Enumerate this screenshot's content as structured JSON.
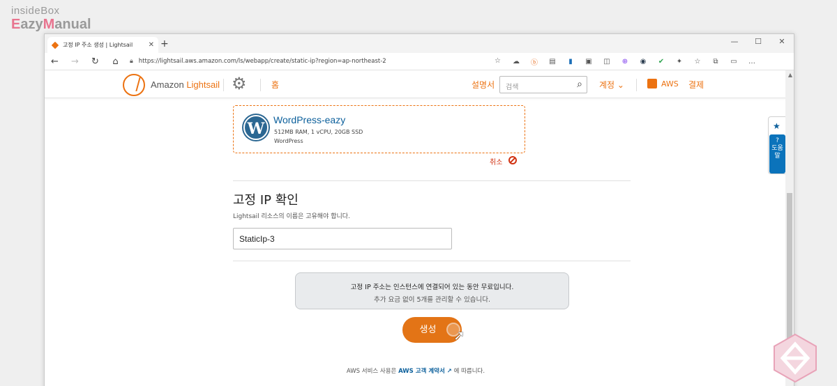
{
  "watermark": {
    "top": "insideBox",
    "bottom_em": "E",
    "bottom_rest": "azy",
    "bottom_em2": "M",
    "bottom_rest2": "anual"
  },
  "browser": {
    "tab_title": "고정 IP 주소 생성 | Lightsail",
    "tab_close": "✕",
    "new_tab": "+",
    "url": "https://lightsail.aws.amazon.com/ls/webapp/create/static-ip?region=ap-northeast-2",
    "window_controls": [
      "—",
      "☐",
      "✕"
    ],
    "nav": {
      "back": "←",
      "forward": "→",
      "reload": "↻",
      "home": "⌂"
    },
    "extensions": [
      "☁",
      "ⓑ",
      "▤",
      "▮",
      "▣",
      "◫",
      "⊕",
      "◉",
      "✔",
      "✦",
      "☆",
      "⧉",
      "▭",
      "…"
    ]
  },
  "header": {
    "brand_prefix": "Amazon ",
    "brand_name": "Lightsail",
    "home": "홈",
    "docs": "설명서",
    "search_placeholder": "검색",
    "account": "계정 ⌄",
    "aws": "AWS",
    "billing": "결제"
  },
  "instance_card": {
    "name": "WordPress-eazy",
    "spec": "512MB RAM, 1 vCPU, 20GB SSD",
    "blueprint": "WordPress",
    "logo_letter": "W"
  },
  "cancel_label": "취소",
  "static_ip": {
    "title": "고정 IP 확인",
    "description": "Lightsail 리소스의 이름은 고유해야 합니다.",
    "name_value": "StaticIp-3"
  },
  "notice": {
    "line1": "고정 IP 주소는 인스턴스에 연결되어 있는 동안 무료입니다.",
    "line2": "추가 요금 없이 5개를 관리할 수 있습니다."
  },
  "create_button": "생성",
  "terms": {
    "prefix": "AWS 서비스 사용은 ",
    "link": "AWS 고객 계약서 ↗",
    "suffix": " 에 따릅니다."
  },
  "side_panel": {
    "help_label": "?\n도움말"
  }
}
